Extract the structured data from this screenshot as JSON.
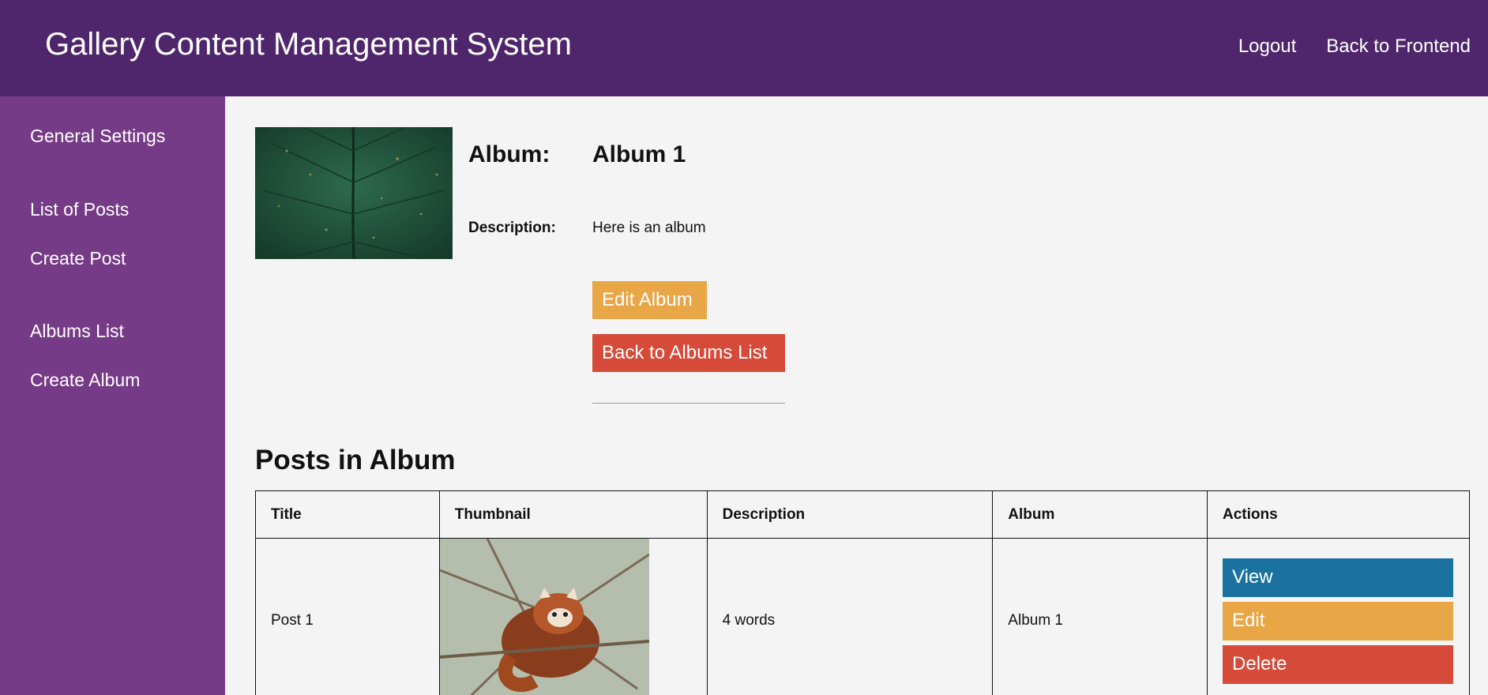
{
  "header": {
    "title": "Gallery Content Management System",
    "links": [
      "Logout",
      "Back to Frontend"
    ]
  },
  "sidebar": {
    "items": [
      {
        "label": "General Settings"
      },
      {
        "label": "List of Posts"
      },
      {
        "label": "Create Post"
      },
      {
        "label": "Albums List"
      },
      {
        "label": "Create Album"
      }
    ]
  },
  "album": {
    "label": "Album:",
    "name": "Album 1",
    "description_label": "Description:",
    "description": "Here is an album",
    "edit_button": "Edit Album",
    "back_button": "Back to Albums List"
  },
  "posts_section": {
    "title": "Posts in Album",
    "columns": [
      "Title",
      "Thumbnail",
      "Description",
      "Album",
      "Actions"
    ],
    "rows": [
      {
        "title": "Post 1",
        "description": "4 words",
        "album": "Album 1",
        "actions": [
          "View",
          "Edit",
          "Delete"
        ]
      }
    ]
  },
  "colors": {
    "header_bg": "#4f266c",
    "sidebar_bg": "#763b86",
    "edit": "#e8a646",
    "delete": "#d54a39",
    "view": "#1b72a0"
  },
  "icons": {
    "album_thumbnail": "leaf-photo",
    "post_thumbnail": "red-panda-photo"
  }
}
